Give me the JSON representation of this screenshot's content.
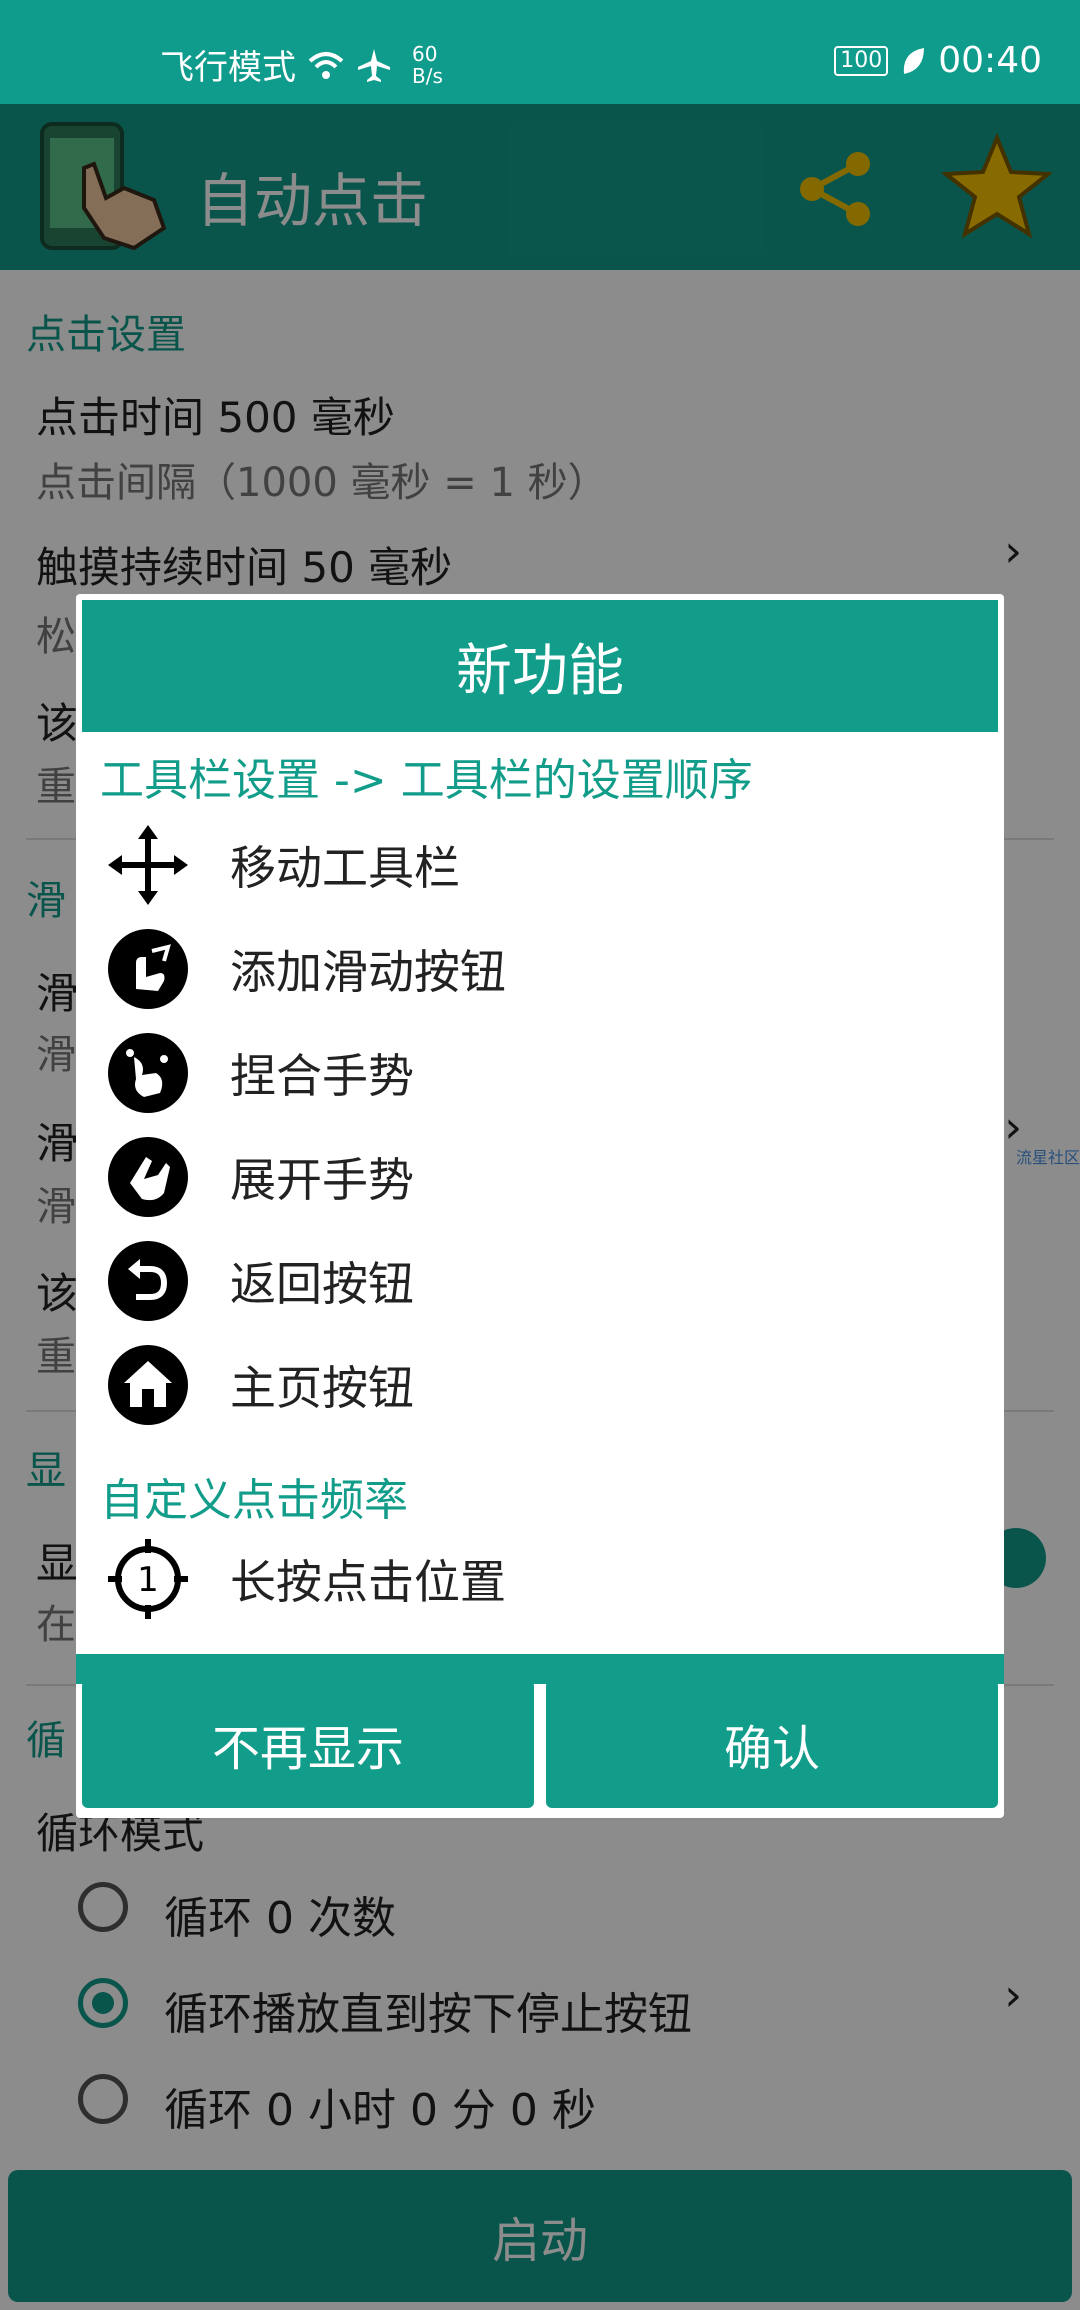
{
  "status_bar": {
    "mode": "飞行模式",
    "speed_value": "60",
    "speed_unit": "B/s",
    "battery": "100",
    "time": "00:40"
  },
  "app_bar": {
    "title": "自动点击"
  },
  "background": {
    "sections": {
      "click_settings": "点击设置",
      "swipe_partial": "滑",
      "display_partial": "显",
      "loop_partial": "循"
    },
    "rows": {
      "click_time_title": "点击时间   500  毫秒",
      "click_time_sub": "点击间隔（1000 毫秒 = 1 秒）",
      "touch_duration_title": "触摸持续时间   50  毫秒",
      "touch_partial": "松",
      "row3_partial": "该",
      "row3_sub_partial": "重",
      "swipe_row1": "滑",
      "swipe_row1_sub": "滑",
      "swipe_row2": "滑",
      "swipe_row2_sub": "滑",
      "swipe_row3": "该",
      "swipe_row3_sub": "重",
      "display_row": "显",
      "display_sub": "在",
      "loop_mode": "循环模式"
    },
    "radio_options": [
      {
        "label": "循环  0  次数",
        "selected": false
      },
      {
        "label": "循环播放直到按下停止按钮",
        "selected": true
      },
      {
        "label": "循环  0  小时  0  分  0  秒",
        "selected": false
      }
    ],
    "side_link": "流星社区",
    "start_button": "启动"
  },
  "dialog": {
    "title": "新功能",
    "section1": "工具栏设置 -> 工具栏的设置顺序",
    "items": [
      {
        "label": "移动工具栏",
        "icon": "move-icon"
      },
      {
        "label": "添加滑动按钮",
        "icon": "swipe-gesture-icon"
      },
      {
        "label": "捏合手势",
        "icon": "pinch-gesture-icon"
      },
      {
        "label": "展开手势",
        "icon": "spread-gesture-icon"
      },
      {
        "label": "返回按钮",
        "icon": "back-icon"
      },
      {
        "label": "主页按钮",
        "icon": "home-icon"
      }
    ],
    "section2": "自定义点击频率",
    "item_long_press": {
      "label": "长按点击位置",
      "icon": "target-icon",
      "badge": "1"
    },
    "buttons": {
      "dont_show": "不再显示",
      "confirm": "确认"
    }
  }
}
